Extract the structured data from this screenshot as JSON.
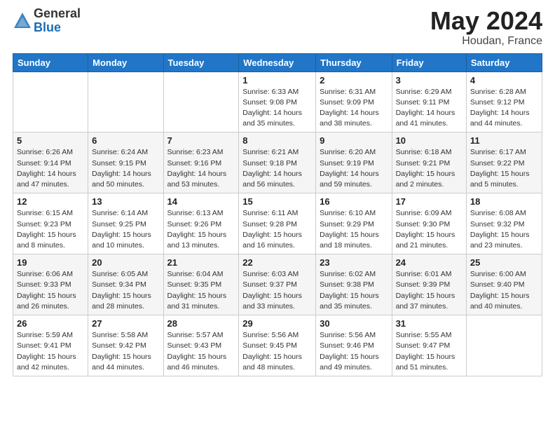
{
  "header": {
    "logo_general": "General",
    "logo_blue": "Blue",
    "title": "May 2024",
    "location": "Houdan, France"
  },
  "days_of_week": [
    "Sunday",
    "Monday",
    "Tuesday",
    "Wednesday",
    "Thursday",
    "Friday",
    "Saturday"
  ],
  "weeks": [
    [
      {
        "day": "",
        "info": ""
      },
      {
        "day": "",
        "info": ""
      },
      {
        "day": "",
        "info": ""
      },
      {
        "day": "1",
        "info": "Sunrise: 6:33 AM\nSunset: 9:08 PM\nDaylight: 14 hours and 35 minutes."
      },
      {
        "day": "2",
        "info": "Sunrise: 6:31 AM\nSunset: 9:09 PM\nDaylight: 14 hours and 38 minutes."
      },
      {
        "day": "3",
        "info": "Sunrise: 6:29 AM\nSunset: 9:11 PM\nDaylight: 14 hours and 41 minutes."
      },
      {
        "day": "4",
        "info": "Sunrise: 6:28 AM\nSunset: 9:12 PM\nDaylight: 14 hours and 44 minutes."
      }
    ],
    [
      {
        "day": "5",
        "info": "Sunrise: 6:26 AM\nSunset: 9:14 PM\nDaylight: 14 hours and 47 minutes."
      },
      {
        "day": "6",
        "info": "Sunrise: 6:24 AM\nSunset: 9:15 PM\nDaylight: 14 hours and 50 minutes."
      },
      {
        "day": "7",
        "info": "Sunrise: 6:23 AM\nSunset: 9:16 PM\nDaylight: 14 hours and 53 minutes."
      },
      {
        "day": "8",
        "info": "Sunrise: 6:21 AM\nSunset: 9:18 PM\nDaylight: 14 hours and 56 minutes."
      },
      {
        "day": "9",
        "info": "Sunrise: 6:20 AM\nSunset: 9:19 PM\nDaylight: 14 hours and 59 minutes."
      },
      {
        "day": "10",
        "info": "Sunrise: 6:18 AM\nSunset: 9:21 PM\nDaylight: 15 hours and 2 minutes."
      },
      {
        "day": "11",
        "info": "Sunrise: 6:17 AM\nSunset: 9:22 PM\nDaylight: 15 hours and 5 minutes."
      }
    ],
    [
      {
        "day": "12",
        "info": "Sunrise: 6:15 AM\nSunset: 9:23 PM\nDaylight: 15 hours and 8 minutes."
      },
      {
        "day": "13",
        "info": "Sunrise: 6:14 AM\nSunset: 9:25 PM\nDaylight: 15 hours and 10 minutes."
      },
      {
        "day": "14",
        "info": "Sunrise: 6:13 AM\nSunset: 9:26 PM\nDaylight: 15 hours and 13 minutes."
      },
      {
        "day": "15",
        "info": "Sunrise: 6:11 AM\nSunset: 9:28 PM\nDaylight: 15 hours and 16 minutes."
      },
      {
        "day": "16",
        "info": "Sunrise: 6:10 AM\nSunset: 9:29 PM\nDaylight: 15 hours and 18 minutes."
      },
      {
        "day": "17",
        "info": "Sunrise: 6:09 AM\nSunset: 9:30 PM\nDaylight: 15 hours and 21 minutes."
      },
      {
        "day": "18",
        "info": "Sunrise: 6:08 AM\nSunset: 9:32 PM\nDaylight: 15 hours and 23 minutes."
      }
    ],
    [
      {
        "day": "19",
        "info": "Sunrise: 6:06 AM\nSunset: 9:33 PM\nDaylight: 15 hours and 26 minutes."
      },
      {
        "day": "20",
        "info": "Sunrise: 6:05 AM\nSunset: 9:34 PM\nDaylight: 15 hours and 28 minutes."
      },
      {
        "day": "21",
        "info": "Sunrise: 6:04 AM\nSunset: 9:35 PM\nDaylight: 15 hours and 31 minutes."
      },
      {
        "day": "22",
        "info": "Sunrise: 6:03 AM\nSunset: 9:37 PM\nDaylight: 15 hours and 33 minutes."
      },
      {
        "day": "23",
        "info": "Sunrise: 6:02 AM\nSunset: 9:38 PM\nDaylight: 15 hours and 35 minutes."
      },
      {
        "day": "24",
        "info": "Sunrise: 6:01 AM\nSunset: 9:39 PM\nDaylight: 15 hours and 37 minutes."
      },
      {
        "day": "25",
        "info": "Sunrise: 6:00 AM\nSunset: 9:40 PM\nDaylight: 15 hours and 40 minutes."
      }
    ],
    [
      {
        "day": "26",
        "info": "Sunrise: 5:59 AM\nSunset: 9:41 PM\nDaylight: 15 hours and 42 minutes."
      },
      {
        "day": "27",
        "info": "Sunrise: 5:58 AM\nSunset: 9:42 PM\nDaylight: 15 hours and 44 minutes."
      },
      {
        "day": "28",
        "info": "Sunrise: 5:57 AM\nSunset: 9:43 PM\nDaylight: 15 hours and 46 minutes."
      },
      {
        "day": "29",
        "info": "Sunrise: 5:56 AM\nSunset: 9:45 PM\nDaylight: 15 hours and 48 minutes."
      },
      {
        "day": "30",
        "info": "Sunrise: 5:56 AM\nSunset: 9:46 PM\nDaylight: 15 hours and 49 minutes."
      },
      {
        "day": "31",
        "info": "Sunrise: 5:55 AM\nSunset: 9:47 PM\nDaylight: 15 hours and 51 minutes."
      },
      {
        "day": "",
        "info": ""
      }
    ]
  ]
}
